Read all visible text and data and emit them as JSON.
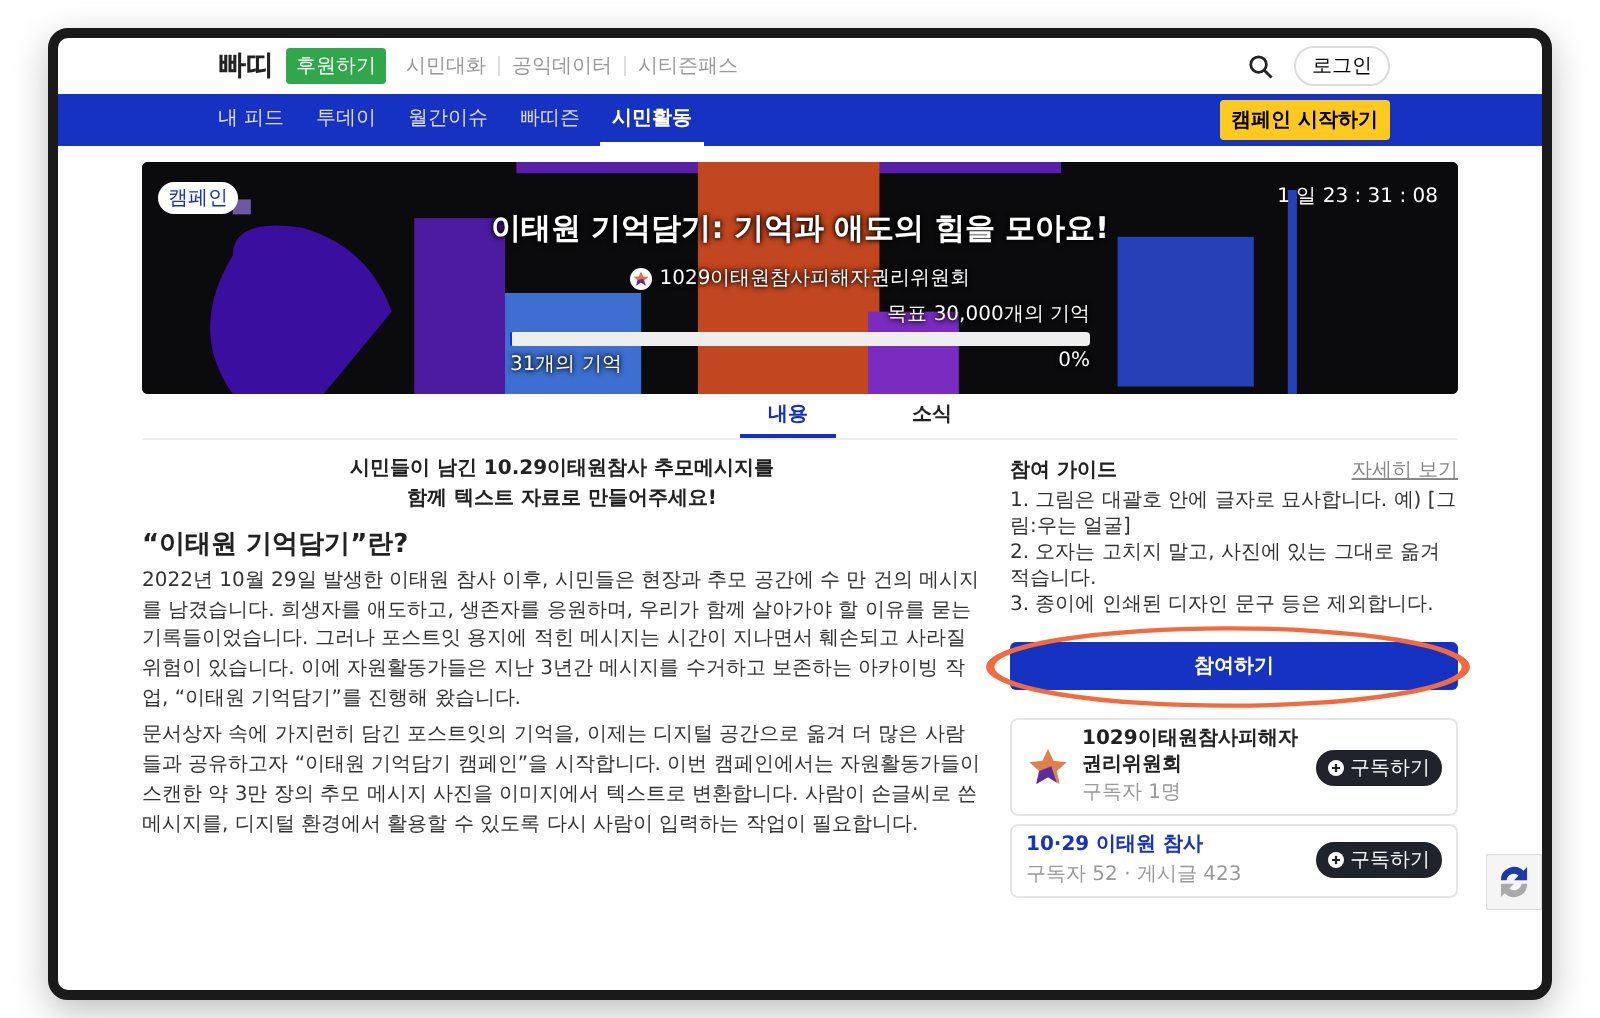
{
  "header": {
    "logo": "빠띠",
    "donate_button": "후원하기",
    "links": [
      "시민대화",
      "공익데이터",
      "시티즌패스"
    ],
    "login_button": "로그인"
  },
  "nav": {
    "items": [
      {
        "label": "내 피드",
        "selected": false
      },
      {
        "label": "투데이",
        "selected": false
      },
      {
        "label": "월간이슈",
        "selected": false
      },
      {
        "label": "빠띠즌",
        "selected": false
      },
      {
        "label": "시민활동",
        "selected": true
      }
    ],
    "cta_button": "캠페인 시작하기"
  },
  "banner": {
    "badge": "캠페인",
    "timer": "1 일 23 : 31 : 08",
    "title": "이태원 기억담기: 기억과 애도의 힘을 모아요!",
    "organizer": "1029이태원참사피해자권리위원회",
    "goal": "목표 30,000개의 기억",
    "level": 0.001,
    "count": "31개의 기억",
    "percent": "0%"
  },
  "content_tabs": [
    {
      "label": "내용",
      "selected": true
    },
    {
      "label": "소식",
      "selected": false
    }
  ],
  "article": {
    "intro_lines": [
      "시민들이 남긴 10.29이태원참사 추모메시지를",
      "함께 텍스트 자료로 만들어주세요!"
    ],
    "heading": "“이태원 기억담기”란?",
    "paragraphs": [
      "2022년 10월 29일 발생한 이태원 참사 이후, 시민들은 현장과 추모 공간에 수 만 건의 메시지를 남겼습니다. 희생자를 애도하고, 생존자를 응원하며, 우리가 함께 살아가야 할 이유를 묻는 기록들이었습니다. 그러나 포스트잇 용지에 적힌 메시지는 시간이 지나면서 훼손되고 사라질 위험이 있습니다. 이에 자원활동가들은 지난 3년간 메시지를 수거하고 보존하는 아카이빙 작업, “이태원 기억담기”를 진행해 왔습니다.",
      "문서상자 속에 가지런히 담긴 포스트잇의 기억을, 이제는 디지털 공간으로 옮겨 더 많은 사람들과 공유하고자 “이태원 기억담기 캠페인”을 시작합니다. 이번 캠페인에서는 자원활동가들이 스캔한 약 3만 장의 추모 메시지 사진을 이미지에서 텍스트로 변환합니다. 사람이 손글씨로 쓴 메시지를, 디지털 환경에서 활용할 수 있도록 다시 사람이 입력하는 작업이 필요합니다."
    ]
  },
  "guide": {
    "title": "참여 가이드",
    "more_link": "자세히 보기",
    "items": [
      "1. 그림은 대괄호 안에 글자로 묘사합니다. 예) [그림:우는 얼굴]",
      "2. 오자는 고치지 말고, 사진에 있는 그대로 옮겨 적습니다.",
      "3. 종이에 인쇄된 디자인 문구 등은 제외합니다."
    ],
    "join_button": "참여하기"
  },
  "cards": [
    {
      "kind": "organization",
      "name": "1029이태원참사피해자권리위원회",
      "meta": "구독자 1명",
      "button": "구독하기"
    },
    {
      "kind": "topic",
      "name": "10·29 이태원 참사",
      "meta": "구독자 52 · 게시글 423",
      "button": "구독하기"
    }
  ]
}
